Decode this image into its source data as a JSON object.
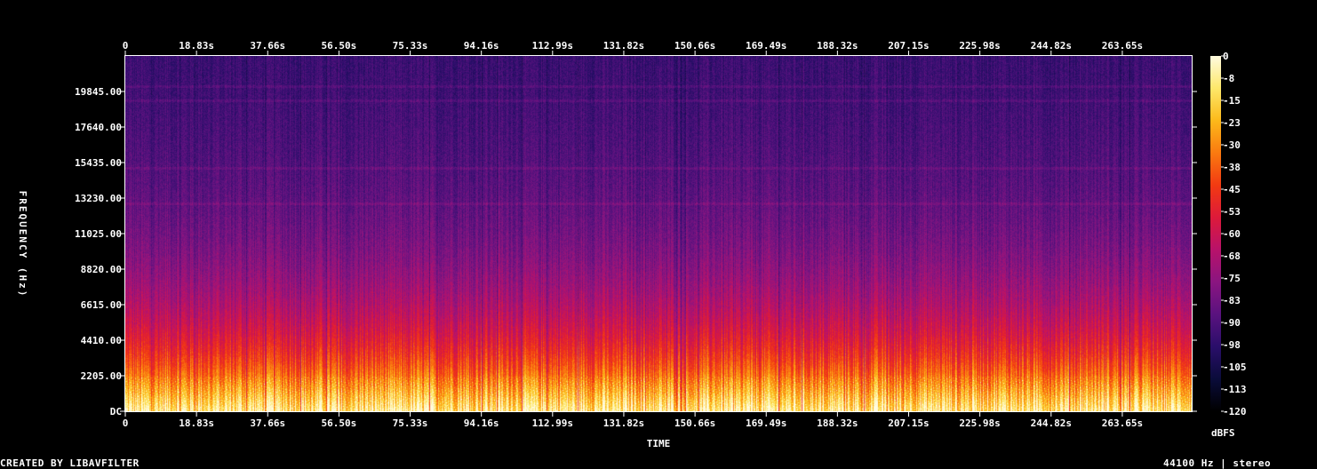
{
  "chart_data": {
    "type": "heatmap",
    "xlabel": "TIME",
    "ylabel": "FREQUENCY (Hz)",
    "x_ticks": [
      "0",
      "18.83s",
      "37.66s",
      "56.50s",
      "75.33s",
      "94.16s",
      "112.99s",
      "131.82s",
      "150.66s",
      "169.49s",
      "188.32s",
      "207.15s",
      "225.98s",
      "244.82s",
      "263.65s"
    ],
    "x_tick_values": [
      0,
      18.83,
      37.66,
      56.5,
      75.33,
      94.16,
      112.99,
      131.82,
      150.66,
      169.49,
      188.32,
      207.15,
      225.98,
      244.82,
      263.65
    ],
    "x_range": [
      0,
      282
    ],
    "y_ticks": [
      "DC",
      "2205.00",
      "4410.00",
      "6615.00",
      "8820.00",
      "11025.00",
      "13230.00",
      "15435.00",
      "17640.00",
      "19845.00"
    ],
    "y_tick_values": [
      0,
      2205,
      4410,
      6615,
      8820,
      11025,
      13230,
      15435,
      17640,
      19845
    ],
    "y_range": [
      0,
      22050
    ],
    "colorbar": {
      "label": "dBFS",
      "ticks": [
        "0",
        "-8",
        "-15",
        "-23",
        "-30",
        "-38",
        "-45",
        "-53",
        "-60",
        "-68",
        "-75",
        "-83",
        "-90",
        "-98",
        "-105",
        "-113",
        "-120"
      ],
      "range": [
        -120,
        0
      ],
      "colormap": [
        "#000000",
        "#0a0c3a",
        "#2a0e6a",
        "#5a127f",
        "#8a1580",
        "#b8126a",
        "#dd1a3a",
        "#f23a12",
        "#fa7a10",
        "#fcb91a",
        "#fde86a",
        "#fffbe0"
      ]
    },
    "audio_end_seconds": 282,
    "bright_bands_hz": [
      12900,
      15100,
      19300,
      20200
    ]
  },
  "footer": {
    "left": "CREATED BY LIBAVFILTER",
    "right": "44100 Hz | stereo"
  }
}
